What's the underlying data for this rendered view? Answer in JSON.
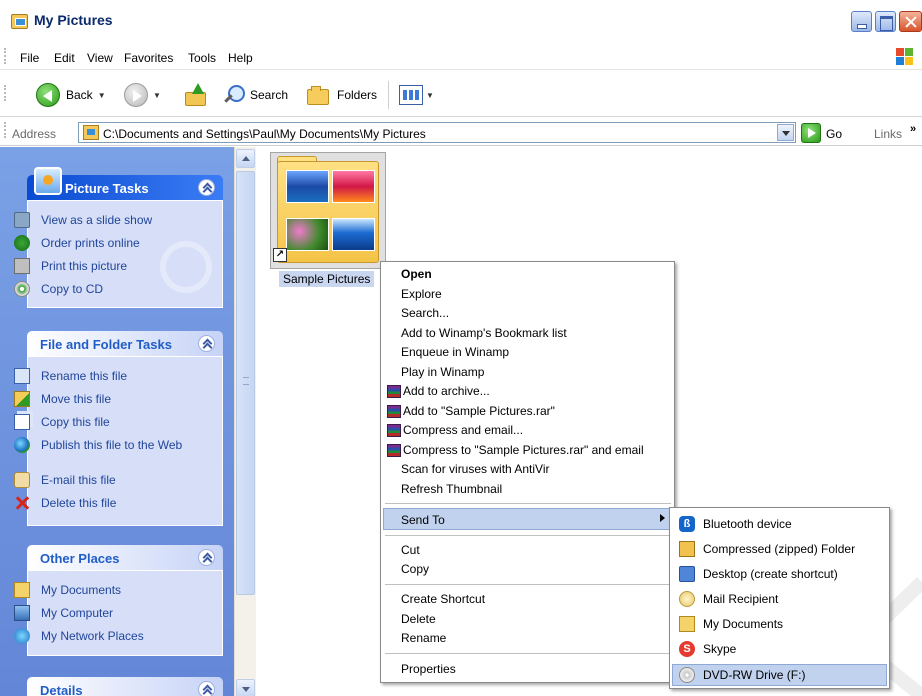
{
  "window": {
    "title": "My Pictures"
  },
  "menu": [
    "File",
    "Edit",
    "View",
    "Favorites",
    "Tools",
    "Help"
  ],
  "toolbar": {
    "back": "Back",
    "search": "Search",
    "folders": "Folders"
  },
  "address": {
    "label": "Address",
    "path": "C:\\Documents and Settings\\Paul\\My Documents\\My Pictures",
    "go": "Go",
    "links": "Links",
    "links_more": "»"
  },
  "sidebar": {
    "picture_tasks": {
      "title": "Picture Tasks",
      "items": [
        "View as a slide show",
        "Order prints online",
        "Print this picture",
        "Copy to CD"
      ]
    },
    "file_folder_tasks": {
      "title": "File and Folder Tasks",
      "items": [
        "Rename this file",
        "Move this file",
        "Copy this file",
        "Publish this file to the Web",
        "E-mail this file",
        "Delete this file"
      ]
    },
    "other_places": {
      "title": "Other Places",
      "items": [
        "My Documents",
        "My Computer",
        "My Network Places"
      ]
    },
    "details": {
      "title": "Details"
    }
  },
  "content": {
    "folder_label": "Sample Pictures"
  },
  "context_menu": {
    "items": [
      "Open",
      "Explore",
      "Search...",
      "Add to Winamp's Bookmark list",
      "Enqueue in Winamp",
      "Play in Winamp",
      "Add to archive...",
      "Add to \"Sample Pictures.rar\"",
      "Compress and email...",
      "Compress to \"Sample Pictures.rar\" and email",
      "Scan for viruses with AntiVir",
      "Refresh Thumbnail",
      "Send To",
      "Cut",
      "Copy",
      "Create Shortcut",
      "Delete",
      "Rename",
      "Properties"
    ],
    "highlighted": "Send To"
  },
  "send_to_menu": {
    "items": [
      {
        "label": "Bluetooth device",
        "icon": "bluetooth-icon"
      },
      {
        "label": "Compressed (zipped) Folder",
        "icon": "zip-folder-icon"
      },
      {
        "label": "Desktop (create shortcut)",
        "icon": "desktop-icon"
      },
      {
        "label": "Mail Recipient",
        "icon": "mail-icon"
      },
      {
        "label": "My Documents",
        "icon": "my-documents-icon"
      },
      {
        "label": "Skype",
        "icon": "skype-icon"
      },
      {
        "label": "DVD-RW Drive (F:)",
        "icon": "dvd-drive-icon"
      }
    ],
    "highlighted": "DVD-RW Drive (F:)"
  },
  "colors": {
    "sidebar_gradient_top": "#7aa1e6",
    "panel_header_special": "#0b4bd1",
    "task_link": "#21459a",
    "menu_highlight": "#c1d2ee"
  }
}
